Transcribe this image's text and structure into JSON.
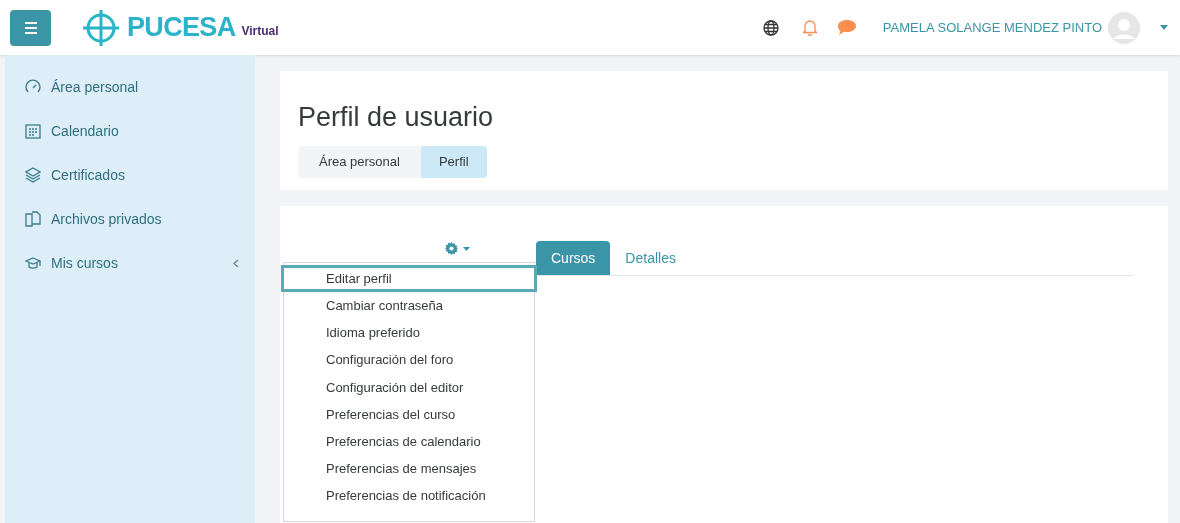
{
  "header": {
    "logo": {
      "name": "PUCESA",
      "suffix": "Virtual"
    },
    "user_name": "PAMELA SOLANGE MENDEZ PINTO"
  },
  "sidebar": {
    "items": [
      {
        "label": "Área personal"
      },
      {
        "label": "Calendario"
      },
      {
        "label": "Certificados"
      },
      {
        "label": "Archivos privados"
      },
      {
        "label": "Mis cursos",
        "expanded": false
      }
    ]
  },
  "page": {
    "title": "Perfil de usuario",
    "breadcrumb": [
      {
        "label": "Área personal",
        "selected": false
      },
      {
        "label": "Perfil",
        "selected": true
      }
    ]
  },
  "tabs": [
    {
      "label": "Cursos",
      "selected": true
    },
    {
      "label": "Detalles",
      "selected": false
    }
  ],
  "settings_menu": [
    {
      "label": "Editar perfil",
      "selected": true
    },
    {
      "label": "Cambiar contraseña",
      "selected": false
    },
    {
      "label": "Idioma preferido",
      "selected": false
    },
    {
      "label": "Configuración del foro",
      "selected": false
    },
    {
      "label": "Configuración del editor",
      "selected": false
    },
    {
      "label": "Preferencias del curso",
      "selected": false
    },
    {
      "label": "Preferencias de calendario",
      "selected": false
    },
    {
      "label": "Preferencias de mensajes",
      "selected": false
    },
    {
      "label": "Preferencias de notificación",
      "selected": false
    }
  ]
}
